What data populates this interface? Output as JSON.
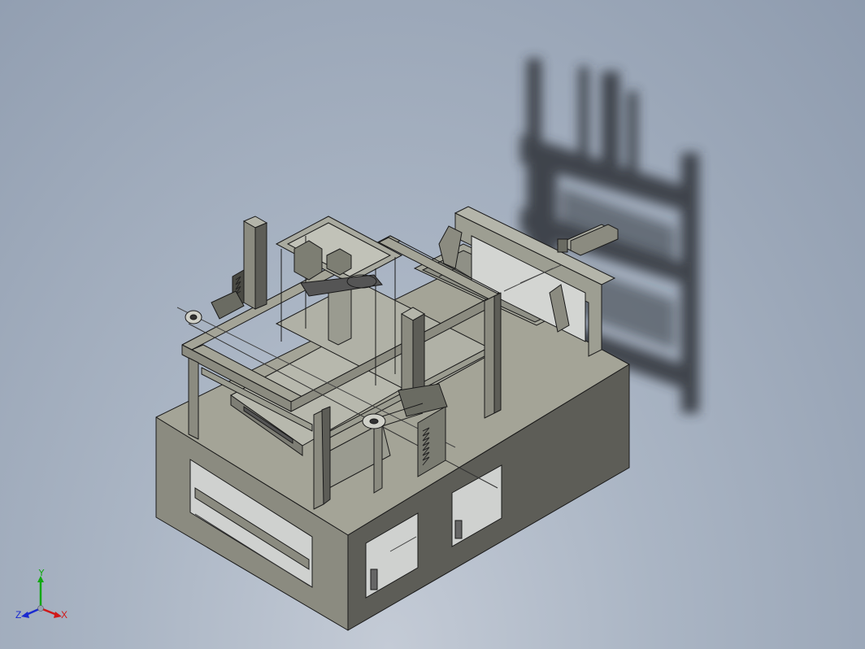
{
  "triad": {
    "x_label": "X",
    "y_label": "Y",
    "z_label": "Z",
    "x_color": "#d01818",
    "y_color": "#12a812",
    "z_color": "#1a2ad0"
  },
  "colors": {
    "background_top": "#8e9bae",
    "background_bottom": "#c4cbd6",
    "model_face_front": "#8b8b80",
    "model_face_top": "#a4a497",
    "model_face_side": "#5d5d57",
    "edge": "#1a1a1a",
    "shadow": "#2e3238"
  },
  "model": {
    "icon": "3d-cad-assembly"
  }
}
